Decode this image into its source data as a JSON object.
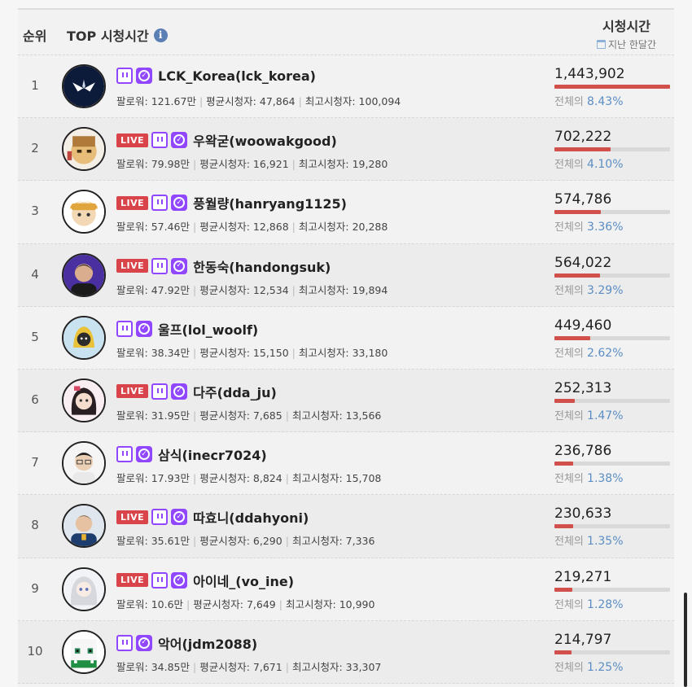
{
  "header": {
    "rank_label": "순위",
    "top_label": "TOP 시청시간",
    "info_icon": "i",
    "watch_title": "시청시간",
    "watch_sub": "지난 한달간"
  },
  "labels": {
    "followers": "팔로워:",
    "avg_viewers": "평균시청자:",
    "max_viewers": "최고시청자:",
    "of_total": "전체의",
    "live": "LIVE"
  },
  "colors": {
    "live": "#d9434a",
    "twitch": "#9146ff",
    "bar": "#d2504b",
    "pct": "#5b8ec4"
  },
  "streamers": [
    {
      "rank": "1",
      "live": false,
      "name": "LCK_Korea(lck_korea)",
      "followers": "121.67만",
      "avg": "47,864",
      "max": "100,094",
      "watch": "1,443,902",
      "pct": "8.43%",
      "share": 1.0,
      "avatar": "lck-logo-avatar"
    },
    {
      "rank": "2",
      "live": true,
      "name": "우왁굳(woowakgood)",
      "followers": "79.98만",
      "avg": "16,921",
      "max": "19,280",
      "watch": "702,222",
      "pct": "4.10%",
      "share": 0.486,
      "avatar": "woowakgood-avatar"
    },
    {
      "rank": "3",
      "live": true,
      "name": "풍월량(hanryang1125)",
      "followers": "57.46만",
      "avg": "12,868",
      "max": "20,288",
      "watch": "574,786",
      "pct": "3.36%",
      "share": 0.398,
      "avatar": "hanryang-avatar"
    },
    {
      "rank": "4",
      "live": true,
      "name": "한동숙(handongsuk)",
      "followers": "47.92만",
      "avg": "12,534",
      "max": "19,894",
      "watch": "564,022",
      "pct": "3.29%",
      "share": 0.391,
      "avatar": "handongsuk-avatar"
    },
    {
      "rank": "5",
      "live": false,
      "name": "울프(lol_woolf)",
      "followers": "38.34만",
      "avg": "15,150",
      "max": "33,180",
      "watch": "449,460",
      "pct": "2.62%",
      "share": 0.311,
      "avatar": "woolf-avatar"
    },
    {
      "rank": "6",
      "live": true,
      "name": "다주(dda_ju)",
      "followers": "31.95만",
      "avg": "7,685",
      "max": "13,566",
      "watch": "252,313",
      "pct": "1.47%",
      "share": 0.175,
      "avatar": "ddaju-avatar"
    },
    {
      "rank": "7",
      "live": false,
      "name": "삼식(inecr7024)",
      "followers": "17.93만",
      "avg": "8,824",
      "max": "15,708",
      "watch": "236,786",
      "pct": "1.38%",
      "share": 0.164,
      "avatar": "inecr-avatar"
    },
    {
      "rank": "8",
      "live": true,
      "name": "따효니(ddahyoni)",
      "followers": "35.61만",
      "avg": "6,290",
      "max": "7,336",
      "watch": "230,633",
      "pct": "1.35%",
      "share": 0.16,
      "avatar": "ddahyoni-avatar"
    },
    {
      "rank": "9",
      "live": true,
      "name": "아이네_(vo_ine)",
      "followers": "10.6만",
      "avg": "7,649",
      "max": "10,990",
      "watch": "219,271",
      "pct": "1.28%",
      "share": 0.152,
      "avatar": "ine-avatar"
    },
    {
      "rank": "10",
      "live": false,
      "name": "악어(jdm2088)",
      "followers": "34.85만",
      "avg": "7,671",
      "max": "33,307",
      "watch": "214,797",
      "pct": "1.25%",
      "share": 0.149,
      "avatar": "jdm-avatar"
    }
  ]
}
